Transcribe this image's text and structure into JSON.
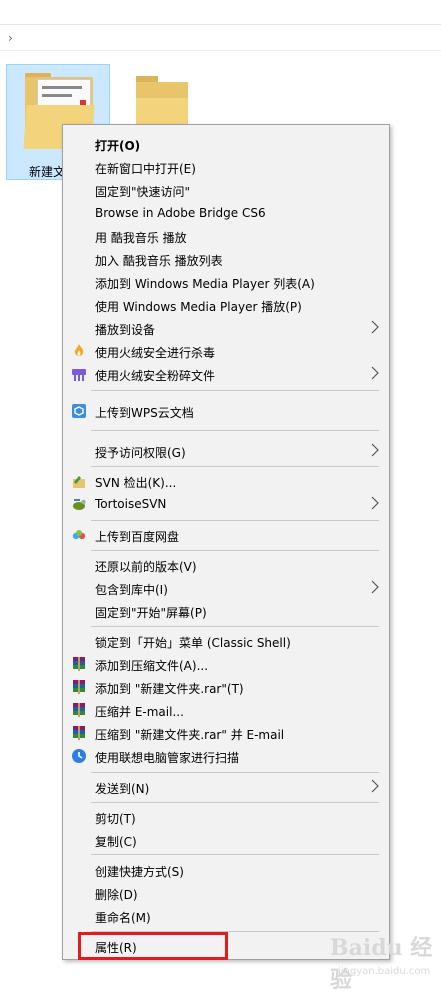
{
  "explorer": {
    "path_chevron": "›",
    "folder_label": "新建文"
  },
  "menu": {
    "items": [
      {
        "label": "打开(O)",
        "bold": true
      },
      {
        "label": "在新窗口中打开(E)"
      },
      {
        "label": "固定到\"快速访问\""
      },
      {
        "label": "Browse in Adobe Bridge CS6"
      },
      {
        "label": "用 酷我音乐 播放"
      },
      {
        "label": "加入 酷我音乐 播放列表"
      },
      {
        "label": "添加到 Windows Media Player 列表(A)"
      },
      {
        "label": "使用 Windows Media Player 播放(P)"
      },
      {
        "label": "播放到设备"
      },
      {
        "label": "使用火绒安全进行杀毒",
        "icon": "huorong-flame-icon"
      },
      {
        "label": "使用火绒安全粉碎文件",
        "icon": "huorong-shredder-icon"
      },
      {
        "label": "上传到WPS云文档",
        "icon": "wps-cloud-icon"
      },
      {
        "label": "授予访问权限(G)"
      },
      {
        "label": "SVN 检出(K)...",
        "icon": "svn-checkout-icon"
      },
      {
        "label": "TortoiseSVN",
        "icon": "tortoisesvn-icon"
      },
      {
        "label": "上传到百度网盘",
        "icon": "baidu-netdisk-icon"
      },
      {
        "label": "还原以前的版本(V)"
      },
      {
        "label": "包含到库中(I)"
      },
      {
        "label": "固定到\"开始\"屏幕(P)"
      },
      {
        "label": "锁定到「开始」菜单 (Classic Shell)"
      },
      {
        "label": "添加到压缩文件(A)...",
        "icon": "winrar-icon"
      },
      {
        "label": "添加到 \"新建文件夹.rar\"(T)",
        "icon": "winrar-icon"
      },
      {
        "label": "压缩并 E-mail...",
        "icon": "winrar-icon"
      },
      {
        "label": "压缩到 \"新建文件夹.rar\" 并 E-mail",
        "icon": "winrar-icon"
      },
      {
        "label": "使用联想电脑管家进行扫描",
        "icon": "lenovo-scan-icon"
      },
      {
        "label": "发送到(N)"
      },
      {
        "label": "剪切(T)"
      },
      {
        "label": "复制(C)"
      },
      {
        "label": "创建快捷方式(S)"
      },
      {
        "label": "删除(D)"
      },
      {
        "label": "重命名(M)"
      },
      {
        "label": "属性(R)"
      }
    ]
  },
  "watermark": {
    "main": "Baidu 经验",
    "sub": "jingyan.baidu.com"
  },
  "colors": {
    "highlight": "#e21b1b",
    "menu_bg": "#f2f2f2",
    "selection_bg": "#cce8ff"
  }
}
